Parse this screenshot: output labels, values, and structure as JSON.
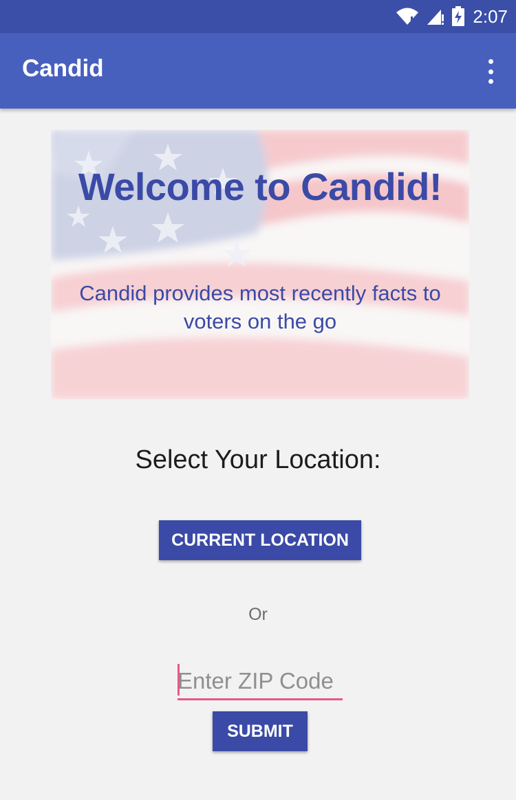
{
  "status_bar": {
    "time": "2:07",
    "icons": [
      "wifi-icon",
      "signal-icon",
      "battery-charging-icon"
    ]
  },
  "app_bar": {
    "title": "Candid",
    "menu_icon": "more-vert-icon"
  },
  "banner": {
    "title": "Welcome to Candid!",
    "subtitle": "Candid provides most recently facts to voters on the go"
  },
  "location": {
    "heading": "Select Your Location:",
    "current_location_label": "CURRENT LOCATION",
    "or_label": "Or",
    "zip_placeholder": "Enter ZIP Code",
    "zip_value": "",
    "submit_label": "SUBMIT"
  },
  "colors": {
    "status_bar": "#3b4fa8",
    "app_bar": "#4760be",
    "accent": "#3a4aa6",
    "input_underline": "#e8578a",
    "background": "#f2f2f2"
  }
}
